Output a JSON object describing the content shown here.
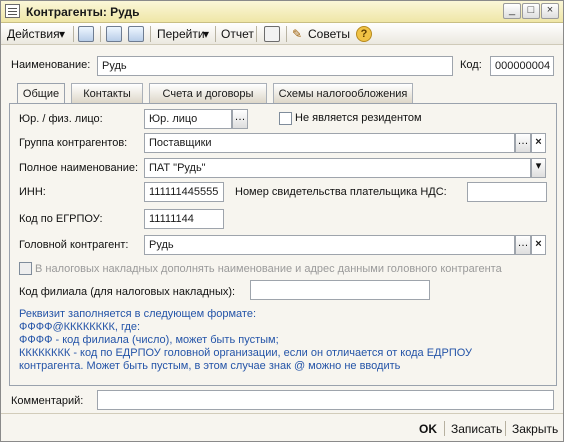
{
  "window": {
    "title": "Контрагенты: Рудь"
  },
  "toolbar": {
    "actions": "Действия",
    "goto": "Перейти",
    "report": "Отчет",
    "tips": "Советы"
  },
  "header": {
    "name_label": "Наименование:",
    "name_value": "Рудь",
    "code_label": "Код:",
    "code_value": "000000004"
  },
  "tabs": [
    {
      "label": "Общие"
    },
    {
      "label": "Контакты"
    },
    {
      "label": "Счета и договоры"
    },
    {
      "label": "Схемы налогообложения"
    }
  ],
  "form": {
    "entity_type_label": "Юр. / физ. лицо:",
    "entity_type_value": "Юр. лицо",
    "nonresident_label": "Не является резидентом",
    "group_label": "Группа контрагентов:",
    "group_value": "Поставщики",
    "fullname_label": "Полное наименование:",
    "fullname_value": "ПАТ \"Рудь\"",
    "inn_label": "ИНН:",
    "inn_value": "111111445555",
    "vat_label": "Номер свидетельства плательщика НДС:",
    "egrpou_label": "Код по ЕГРПОУ:",
    "egrpou_value": "11111144",
    "head_label": "Головной контрагент:",
    "head_value": "Рудь",
    "head_invoice_label": "В налоговых накладных дополнять наименование и адрес данными головного контрагента",
    "branch_label": "Код филиала (для налоговых накладных):"
  },
  "note": {
    "line1": "Реквизит заполняется в следующем формате:",
    "line2": "ФФФФ@КККККККК, где:",
    "line3": "ФФФФ - код филиала (число), может быть пустым;",
    "line4": "КККККККК - код по ЕДРПОУ головной организации, если он отличается от кода ЕДРПОУ",
    "line5": "контрагента. Может быть пустым, в этом случае знак @ можно не вводить"
  },
  "comment": {
    "label": "Комментарий:"
  },
  "footer": {
    "ok": "OK",
    "save": "Записать",
    "close": "Закрыть"
  },
  "icons": [
    "document-icon",
    "minimize-icon",
    "maximize-icon",
    "close-icon",
    "dropdown-arrow-icon",
    "help-icon"
  ]
}
